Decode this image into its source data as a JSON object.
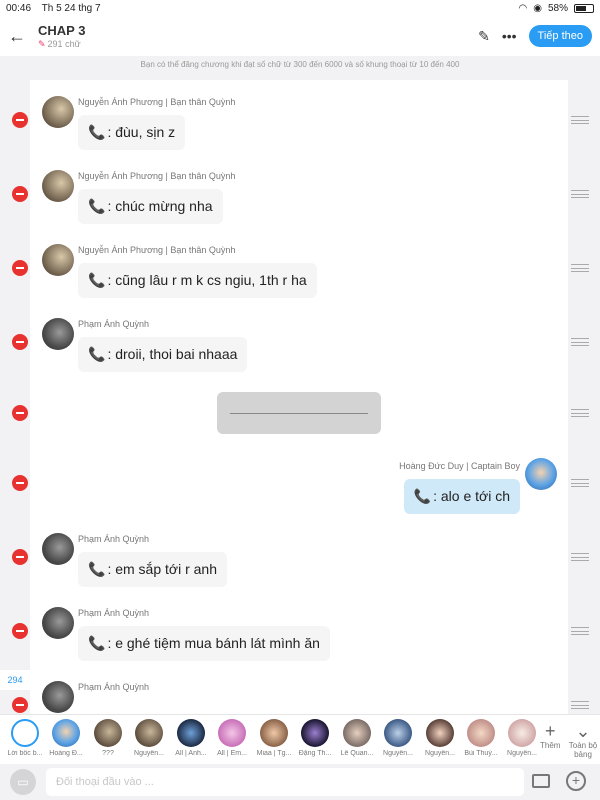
{
  "status_bar": {
    "time": "00:46",
    "date": "Th 5 24 thg 7",
    "battery": "58%",
    "battery_level": 0.58
  },
  "header": {
    "title": "CHAP 3",
    "word_count": "291 chữ",
    "next_label": "Tiếp theo"
  },
  "notice": "Bạn có thể đăng chương khi đạt số chữ từ 300 đến 6000 và số khung thoại từ 10 đến 400",
  "messages": [
    {
      "sender": "Nguyễn Ánh Phương | Bạn thân Quỳnh",
      "text": ": đùu, sịn z"
    },
    {
      "sender": "Nguyễn Ánh Phương | Bạn thân Quỳnh",
      "text": ": chúc mừng nha"
    },
    {
      "sender": "Nguyễn Ánh Phương | Bạn thân Quỳnh",
      "text": ": cũng lâu r m k cs ngiu, 1th r ha"
    },
    {
      "sender": "Phạm Ánh Quỳnh",
      "text": ": droii, thoi bai nhaaa"
    },
    {
      "sender": "Hoàng Đức Duy | Captain Boy",
      "text": ": alo e tới ch"
    },
    {
      "sender": "Phạm Ánh Quỳnh",
      "text": ": em sắp tới r anh"
    },
    {
      "sender": "Phạm Ánh Quỳnh",
      "text": ": e ghé tiệm mua bánh lát mình ăn"
    },
    {
      "sender": "Phạm Ánh Quỳnh",
      "text": ""
    }
  ],
  "dialog_count": "294",
  "characters": [
    "Lời bốc b...",
    "Hoàng Đ...",
    "???",
    "Nguyễn...",
    "All | Anh...",
    "All | Em...",
    "Miaa | Tg...",
    "Đặng Th...",
    "Lê Quan...",
    "Nguyễn...",
    "Nguyễn...",
    "Bùi Thuỳ...",
    "Nguyễn..."
  ],
  "strip_buttons": {
    "more": "Thêm",
    "fullscreen": "Toàn bộ bảng"
  },
  "input": {
    "placeholder": "Đối thoại đầu vào ..."
  },
  "colors": {
    "accent": "#2a9cf3",
    "remove": "#e8322f",
    "right_bubble": "#cfe9f8"
  }
}
